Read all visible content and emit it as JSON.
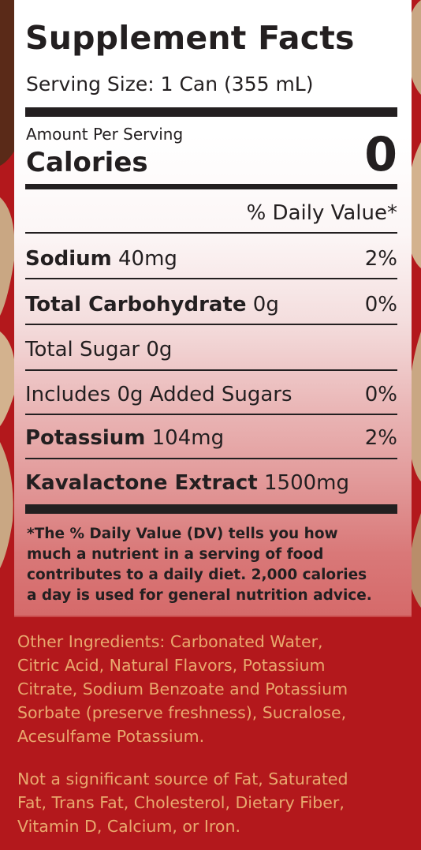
{
  "label": {
    "title": "Supplement Facts",
    "serving_size": "Serving Size: 1 Can (355 mL)",
    "amount_per_serving": "Amount Per Serving",
    "calories_label": "Calories",
    "calories_value": "0",
    "daily_value_header": "% Daily Value*",
    "rows": [
      {
        "bold": "Sodium",
        "amount": " 40mg",
        "dv": "2%"
      },
      {
        "bold": "Total Carbohydrate",
        "amount": " 0g",
        "dv": "0%"
      },
      {
        "bold": "",
        "amount": "Total Sugar 0g",
        "dv": ""
      },
      {
        "bold": "",
        "amount": "Includes 0g Added Sugars",
        "dv": "0%"
      },
      {
        "bold": "Potassium",
        "amount": " 104mg",
        "dv": "2%"
      },
      {
        "bold": "Kavalactone Extract",
        "amount": " 1500mg",
        "dv": ""
      }
    ],
    "footnote_lines": [
      "*The % Daily Value (DV) tells you how",
      "much a nutrient in a serving of food",
      "contributes to a daily diet. 2,000 calories",
      "a day is used for general nutrition advice."
    ]
  },
  "ingredients_lines": [
    "Other Ingredients: Carbonated Water,",
    "Citric Acid, Natural Flavors, Potassium",
    "Citrate, Sodium Benzoate and Potassium",
    "Sorbate (preserve freshness), Sucralose,",
    "Acesulfame Potassium."
  ],
  "not_significant_lines": [
    "Not a significant source of Fat, Saturated",
    "Fat, Trans Fat, Cholesterol, Dietary Fiber,",
    "Vitamin D, Calcium, or Iron."
  ],
  "colors": {
    "background_red": "#b3181c",
    "ink": "#231f20",
    "ingredient_text": "#e8a96e",
    "accent_tan": "#c9a783",
    "accent_brown": "#5a2a18"
  }
}
